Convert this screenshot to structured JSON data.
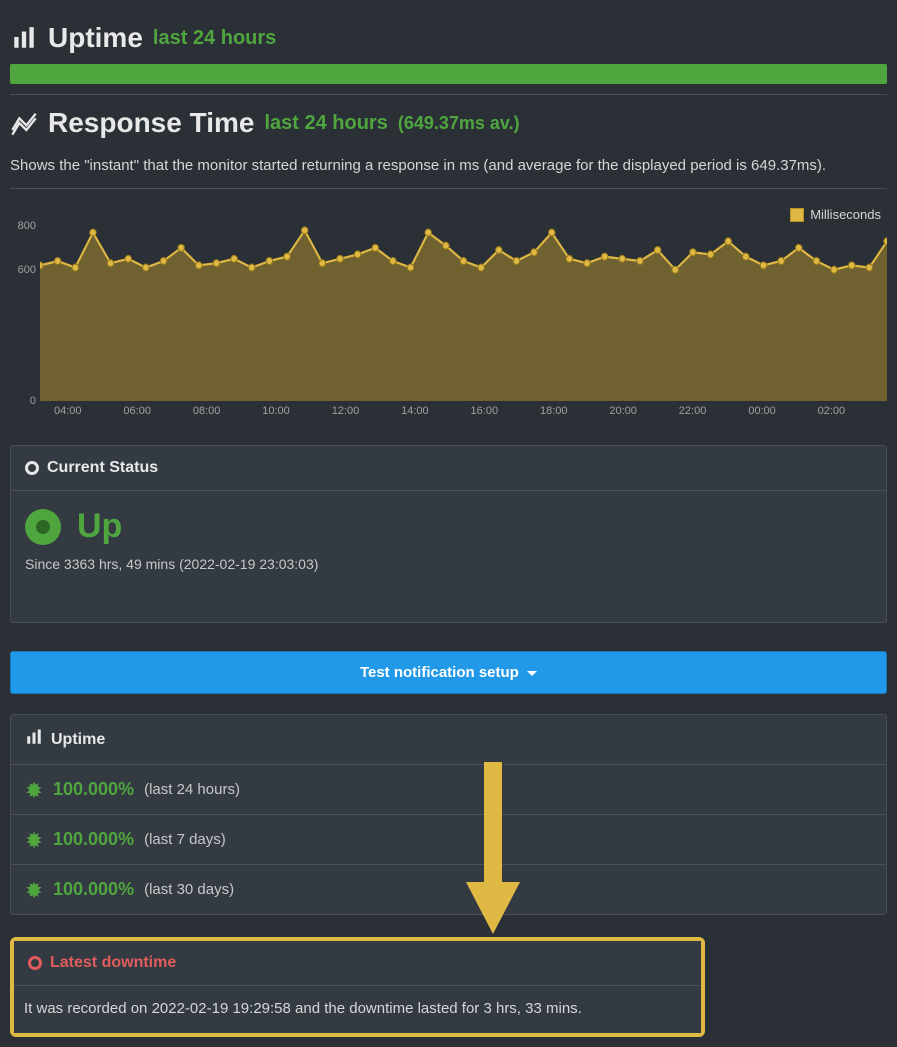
{
  "uptime_section": {
    "title": "Uptime",
    "subtitle": "last 24 hours"
  },
  "response_section": {
    "title": "Response Time",
    "subtitle": "last 24 hours",
    "avg_label": "(649.37ms av.)",
    "description": "Shows the \"instant\" that the monitor started returning a response in ms (and average for the displayed period is 649.37ms).",
    "legend": "Milliseconds"
  },
  "chart_data": {
    "type": "area",
    "ylabel": "ms",
    "ylim": [
      0,
      800
    ],
    "y_ticks": [
      0,
      600,
      800
    ],
    "x_ticks": [
      "04:00",
      "06:00",
      "08:00",
      "10:00",
      "12:00",
      "14:00",
      "16:00",
      "18:00",
      "20:00",
      "22:00",
      "00:00",
      "02:00"
    ],
    "x": [
      "03:00",
      "03:30",
      "04:00",
      "04:30",
      "05:00",
      "05:30",
      "06:00",
      "06:30",
      "07:00",
      "07:30",
      "08:00",
      "08:30",
      "09:00",
      "09:30",
      "10:00",
      "10:30",
      "11:00",
      "11:30",
      "12:00",
      "12:30",
      "13:00",
      "13:30",
      "14:00",
      "14:30",
      "15:00",
      "15:30",
      "16:00",
      "16:30",
      "17:00",
      "17:30",
      "18:00",
      "18:30",
      "19:00",
      "19:30",
      "20:00",
      "20:30",
      "21:00",
      "21:30",
      "22:00",
      "22:30",
      "23:00",
      "23:30",
      "00:00",
      "00:30",
      "01:00",
      "01:30",
      "02:00",
      "02:30",
      "03:00"
    ],
    "values": [
      620,
      640,
      610,
      770,
      630,
      650,
      610,
      640,
      700,
      620,
      630,
      650,
      610,
      640,
      660,
      780,
      630,
      650,
      670,
      700,
      640,
      610,
      770,
      710,
      640,
      610,
      690,
      640,
      680,
      770,
      650,
      630,
      660,
      650,
      640,
      690,
      600,
      680,
      670,
      730,
      660,
      620,
      640,
      700,
      640,
      600,
      620,
      610,
      730
    ]
  },
  "current_status": {
    "header": "Current Status",
    "status": "Up",
    "since": "Since 3363 hrs, 49 mins (2022-02-19 23:03:03)"
  },
  "test_button": "Test notification setup",
  "uptime_panel": {
    "header": "Uptime",
    "rows": [
      {
        "pct": "100.000%",
        "range": "(last 24 hours)"
      },
      {
        "pct": "100.000%",
        "range": "(last 7 days)"
      },
      {
        "pct": "100.000%",
        "range": "(last 30 days)"
      }
    ]
  },
  "latest_downtime": {
    "header": "Latest downtime",
    "text": "It was recorded on 2022-02-19 19:29:58 and the downtime lasted for 3 hrs, 33 mins."
  }
}
